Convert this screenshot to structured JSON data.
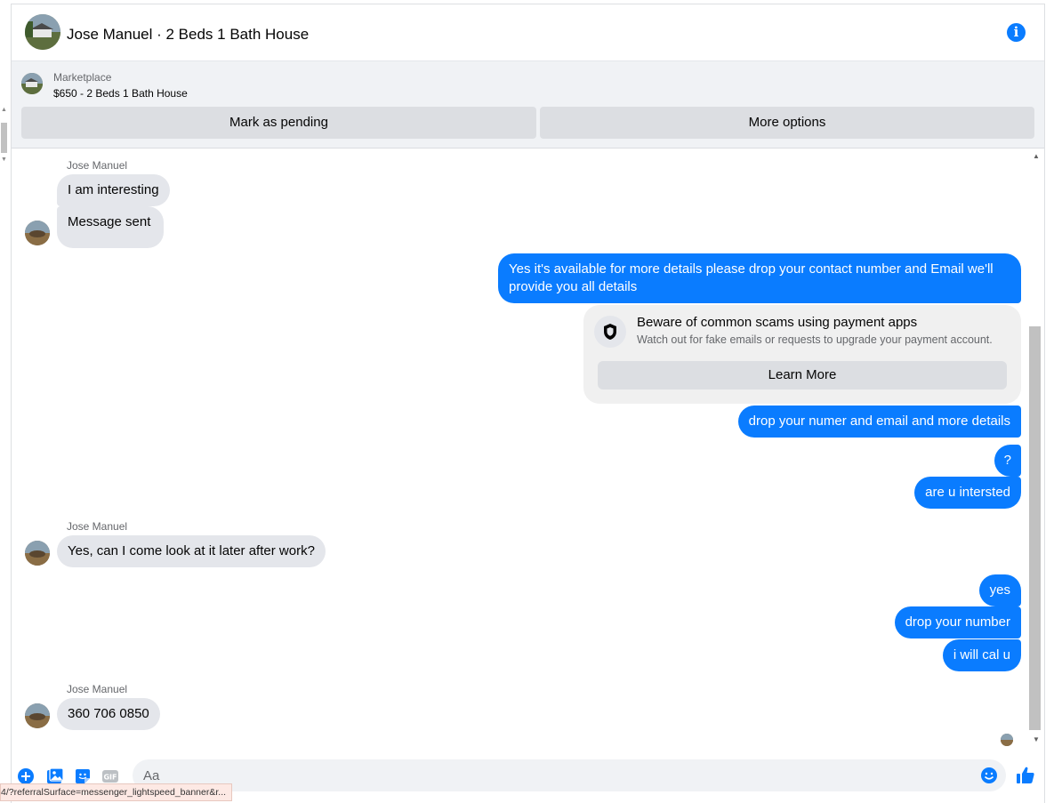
{
  "header": {
    "title": "Jose Manuel · 2 Beds 1 Bath House"
  },
  "marketplace": {
    "label": "Marketplace",
    "listing": "$650 - 2 Beds 1 Bath House",
    "mark_pending_label": "Mark as pending",
    "more_options_label": "More options"
  },
  "messages": {
    "sender_name": "Jose Manuel",
    "in_1a": "I am interesting",
    "in_1b": "Message sent",
    "out_1": "Yes it's available for more details please drop your contact number and Email we'll provide you all details",
    "scam": {
      "title": "Beware of common scams using payment apps",
      "subtitle": "Watch out for fake emails or requests to upgrade your payment account.",
      "learn_more": "Learn More"
    },
    "out_2": "drop your numer and email and more details",
    "out_3": "?",
    "out_4": "are u intersted",
    "in_2": "Yes, can I come look at it later after work?",
    "out_5": "yes",
    "out_6": "drop your number",
    "out_7": "i will cal u",
    "in_3": "360 706 0850"
  },
  "composer": {
    "placeholder": "Aa"
  },
  "status_bar": {
    "url": "4/?referralSurface=messenger_lightspeed_banner&r..."
  },
  "colors": {
    "accent": "#0a7cff",
    "incoming_bubble": "#e4e6eb",
    "panel_bg": "#f0f2f5"
  }
}
